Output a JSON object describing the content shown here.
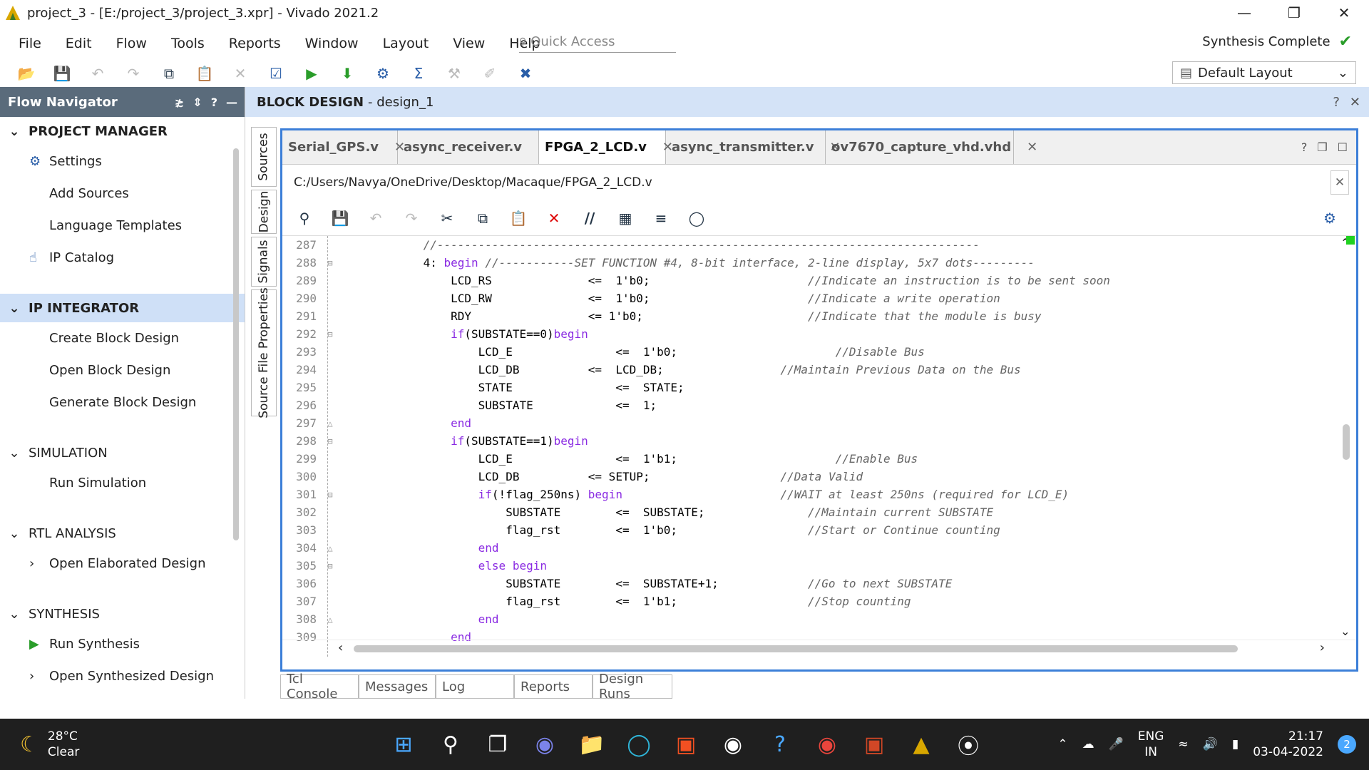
{
  "window": {
    "title": "project_3 - [E:/project_3/project_3.xpr] - Vivado 2021.2"
  },
  "menu": [
    "File",
    "Edit",
    "Flow",
    "Tools",
    "Reports",
    "Window",
    "Layout",
    "View",
    "Help"
  ],
  "quick_access": {
    "placeholder": "Quick Access"
  },
  "status": {
    "text": "Synthesis Complete"
  },
  "layout_selector": {
    "value": "Default Layout"
  },
  "flow_navigator": {
    "title": "Flow Navigator",
    "sections": [
      {
        "label": "PROJECT MANAGER",
        "items": [
          "Settings",
          "Add Sources",
          "Language Templates",
          "IP Catalog"
        ]
      },
      {
        "label": "IP INTEGRATOR",
        "items": [
          "Create Block Design",
          "Open Block Design",
          "Generate Block Design"
        ]
      },
      {
        "label": "SIMULATION",
        "items": [
          "Run Simulation"
        ]
      },
      {
        "label": "RTL ANALYSIS",
        "items": [
          "Open Elaborated Design"
        ]
      },
      {
        "label": "SYNTHESIS",
        "items": [
          "Run Synthesis",
          "Open Synthesized Design"
        ]
      }
    ]
  },
  "block_design": {
    "label": "BLOCK DESIGN",
    "name": "- design_1"
  },
  "side_tabs": [
    "Sources",
    "Design",
    "Signals",
    "Source File Properties"
  ],
  "editor": {
    "tabs": [
      "Serial_GPS.v",
      "async_receiver.v",
      "FPGA_2_LCD.v",
      "async_transmitter.v",
      "ov7670_capture_vhd.vhd"
    ],
    "active_tab": "FPGA_2_LCD.v",
    "file_path": "C:/Users/Navya/OneDrive/Desktop/Macaque/FPGA_2_LCD.v"
  },
  "code_lines": [
    {
      "n": "287",
      "code": "            ",
      "cm": "//-------------------------------------------------------------------------------"
    },
    {
      "n": "288",
      "code": "            4: begin ",
      "cm": "//-----------SET FUNCTION #4, 8-bit interface, 2-line display, 5x7 dots---------"
    },
    {
      "n": "289",
      "code": "                LCD_RS              <=  1'b0;                       ",
      "cm": "//Indicate an instruction is to be sent soon"
    },
    {
      "n": "290",
      "code": "                LCD_RW              <=  1'b0;                       ",
      "cm": "//Indicate a write operation"
    },
    {
      "n": "291",
      "code": "                RDY                 <= 1'b0;                        ",
      "cm": "//Indicate that the module is busy"
    },
    {
      "n": "292",
      "code": "                if(SUBSTATE==0)begin",
      "cm": ""
    },
    {
      "n": "293",
      "code": "                    LCD_E               <=  1'b0;                       ",
      "cm": "//Disable Bus"
    },
    {
      "n": "294",
      "code": "                    LCD_DB          <=  LCD_DB;                 ",
      "cm": "//Maintain Previous Data on the Bus"
    },
    {
      "n": "295",
      "code": "                    STATE               <=  STATE;",
      "cm": ""
    },
    {
      "n": "296",
      "code": "                    SUBSTATE            <=  1;",
      "cm": ""
    },
    {
      "n": "297",
      "code": "                end",
      "cm": ""
    },
    {
      "n": "298",
      "code": "                if(SUBSTATE==1)begin",
      "cm": ""
    },
    {
      "n": "299",
      "code": "                    LCD_E               <=  1'b1;                       ",
      "cm": "//Enable Bus"
    },
    {
      "n": "300",
      "code": "                    LCD_DB          <= SETUP;                   ",
      "cm": "//Data Valid"
    },
    {
      "n": "301",
      "code": "                    if(!flag_250ns) begin                       ",
      "cm": "//WAIT at least 250ns (required for LCD_E)"
    },
    {
      "n": "302",
      "code": "                        SUBSTATE        <=  SUBSTATE;               ",
      "cm": "//Maintain current SUBSTATE"
    },
    {
      "n": "303",
      "code": "                        flag_rst        <=  1'b0;                   ",
      "cm": "//Start or Continue counting"
    },
    {
      "n": "304",
      "code": "                    end",
      "cm": ""
    },
    {
      "n": "305",
      "code": "                    else begin",
      "cm": ""
    },
    {
      "n": "306",
      "code": "                        SUBSTATE        <=  SUBSTATE+1;             ",
      "cm": "//Go to next SUBSTATE"
    },
    {
      "n": "307",
      "code": "                        flag_rst        <=  1'b1;                   ",
      "cm": "//Stop counting"
    },
    {
      "n": "308",
      "code": "                    end",
      "cm": ""
    },
    {
      "n": "309",
      "code": "                end",
      "cm": ""
    }
  ],
  "bottom_tabs": [
    "Tcl Console",
    "Messages",
    "Log",
    "Reports",
    "Design Runs"
  ],
  "taskbar": {
    "temperature": "28°C",
    "weather": "Clear",
    "language": "ENG",
    "region": "IN",
    "time": "21:17",
    "date": "03-04-2022",
    "notifications": "2"
  }
}
